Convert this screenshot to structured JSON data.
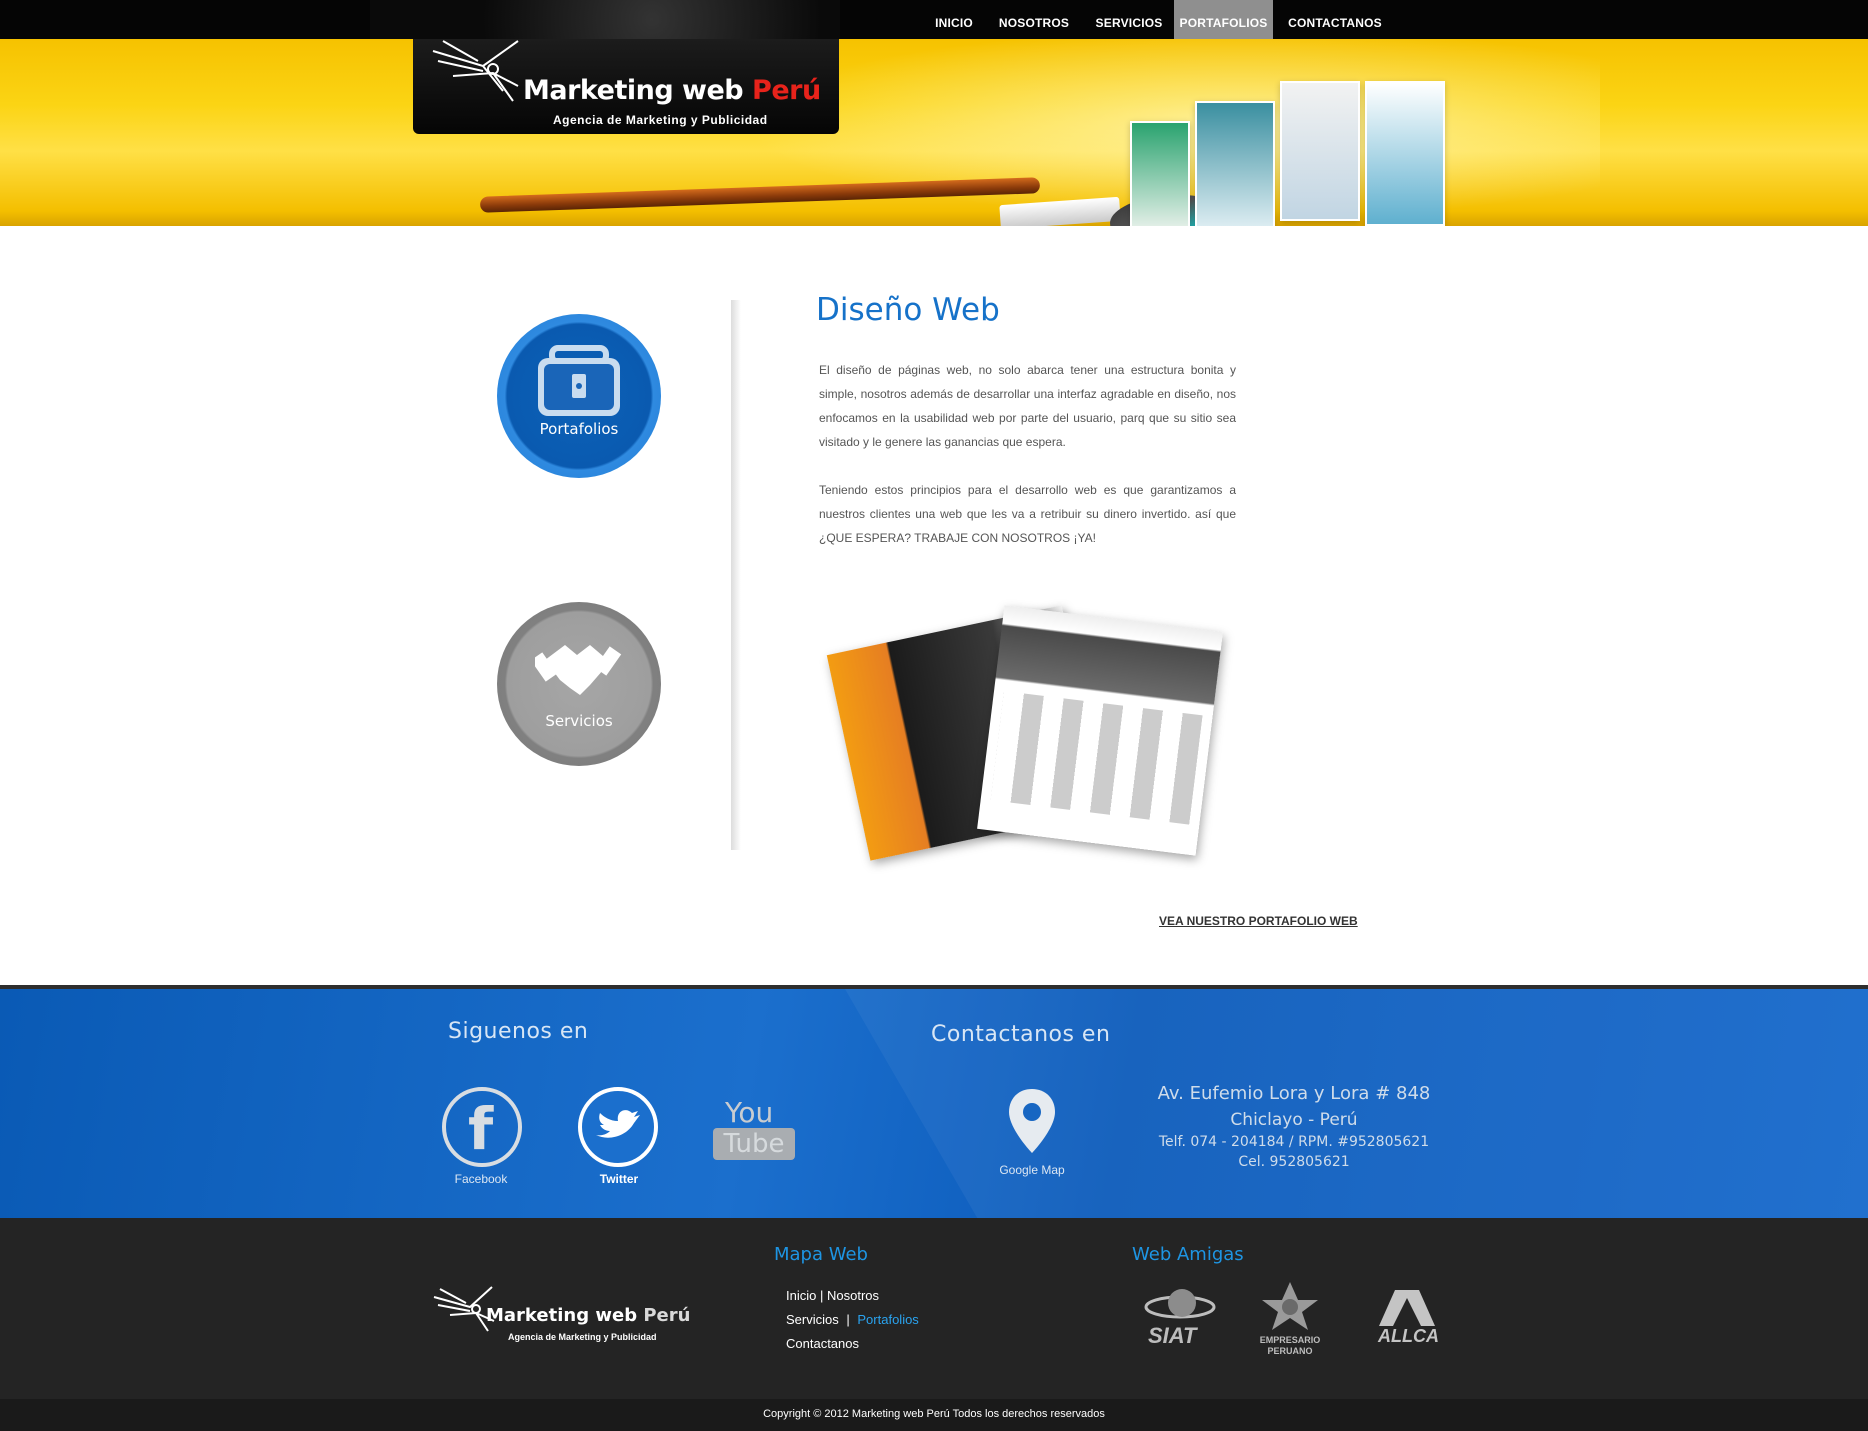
{
  "nav": {
    "items": [
      {
        "label": "INICIO",
        "active": false
      },
      {
        "label": "NOSOTROS",
        "active": false
      },
      {
        "label": "SERVICIOS",
        "active": false
      },
      {
        "label": "PORTAFOLIOS",
        "active": true
      },
      {
        "label": "CONTACTANOS",
        "active": false
      }
    ]
  },
  "brand": {
    "name_part1": "Marketing web ",
    "name_part2": "Perú",
    "tagline": "Agencia de Marketing y Publicidad"
  },
  "sidebar": {
    "portafolios_label": "Portafolios",
    "servicios_label": "Servicios"
  },
  "main": {
    "title": "Diseño Web",
    "paragraph1": "El diseño de páginas web, no solo abarca tener una estructura bonita y simple, nosotros además de desarrollar una interfaz agradable en diseño, nos enfocamos en la usabilidad web por parte del usuario, parq que su sitio sea visitado y le genere las ganancias que espera.",
    "paragraph2": "Teniendo estos principios para el desarrollo web es que garantizamos a nuestros clientes una web que les va a retribuir su dinero invertido. así que ¿QUE ESPERA? TRABAJE CON NOSOTROS ¡YA!",
    "portfolio_link": "VEA NUESTRO PORTAFOLIO WEB"
  },
  "social": {
    "title": "Siguenos en",
    "facebook": "Facebook",
    "twitter": "Twitter",
    "youtube_top": "You",
    "youtube_bottom": "Tube"
  },
  "contact": {
    "title": "Contactanos en",
    "map_label": "Google Map",
    "address": "Av. Eufemio Lora y Lora # 848",
    "city": "Chiclayo - Perú",
    "phone": "Telf. 074 - 204184 / RPM. #952805621",
    "cell": "Cel. 952805621"
  },
  "footer": {
    "map_title": "Mapa Web",
    "link_inicio": "Inicio",
    "sep1": "|",
    "link_nosotros": "Nosotros",
    "link_servicios": "Servicios",
    "sep2": "|",
    "link_portafolios": "Portafolios",
    "link_contactanos": "Contactanos",
    "friends_title": "Web Amigas",
    "friend1": "SIAT",
    "friend2_line1": "EMPRESARIO",
    "friend2_line2": "PERUANO",
    "friend3": "ALLCA",
    "copyright": "Copyright © 2012   Marketing web Perú Todos los derechos reservados"
  },
  "colors": {
    "accent_blue": "#1672c9",
    "banner_yellow": "#fbd414",
    "footer_blue": "#0c5bbb",
    "footer_dark": "#242424"
  }
}
